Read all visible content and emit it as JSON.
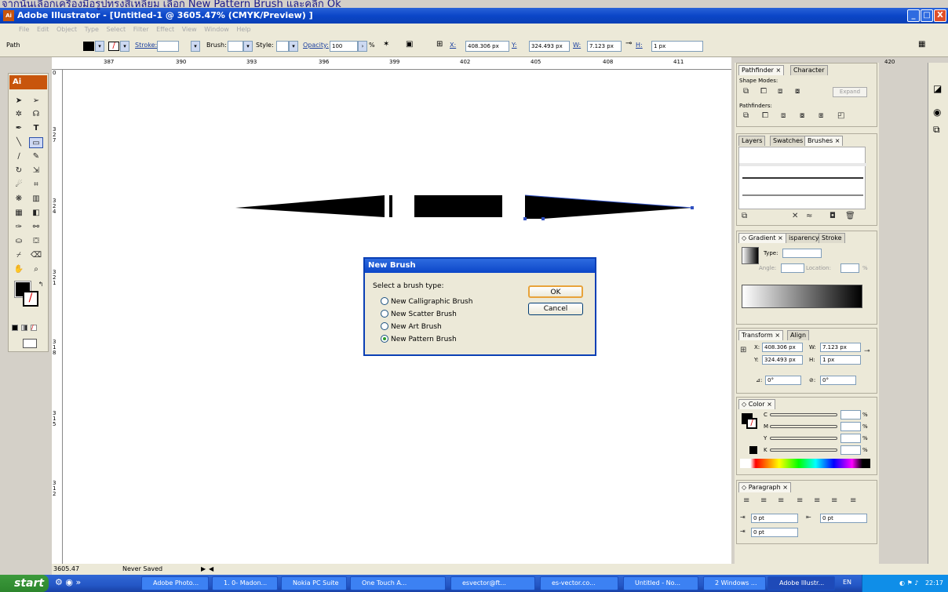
{
  "caption": "จากนั้นเลือกเครื่องมือรูปทรงสี่เหลี่ยม เลือก New Pattern Brush และคลิก Ok",
  "window": {
    "title": "Adobe Illustrator - [Untitled-1 @ 3605.47% (CMYK/Preview) ]",
    "min": "_",
    "max": "□",
    "close": "X"
  },
  "menu": [
    "File",
    "Edit",
    "Object",
    "Type",
    "Select",
    "Filter",
    "Effect",
    "View",
    "Window",
    "Help"
  ],
  "control": {
    "path_label": "Path",
    "stroke_label": "Stroke:",
    "brush_label": "Brush:",
    "style_label": "Style:",
    "opacity_label": "Opacity:",
    "opacity_value": "100",
    "percent": "%",
    "x_label": "X:",
    "x_value": "408.306 px",
    "y_label": "Y:",
    "y_value": "324.493 px",
    "w_label": "W:",
    "w_value": "7.123 px",
    "h_label": "H:",
    "h_value": "1 px"
  },
  "ruler_top": [
    "387",
    "390",
    "393",
    "396",
    "399",
    "402",
    "405",
    "408",
    "411",
    "420"
  ],
  "ruler_left": [
    "3\n2\n7",
    "3\n2\n4",
    "3\n2\n1",
    "3\n1\n8",
    "3\n1\n5",
    "3\n1\n2"
  ],
  "ruler_left_top": "0",
  "toolbox": {
    "logo": "Ai"
  },
  "dialog": {
    "title": "New Brush",
    "prompt": "Select a brush type:",
    "options": [
      "New Calligraphic Brush",
      "New Scatter Brush",
      "New Art Brush",
      "New Pattern Brush"
    ],
    "selected": "New Pattern Brush",
    "ok": "OK",
    "cancel": "Cancel"
  },
  "panels": {
    "pathfinder": {
      "tab1": "Pathfinder ×",
      "tab2": "Character",
      "shape_modes": "Shape Modes:",
      "expand": "Expand",
      "pathfinders": "Pathfinders:"
    },
    "brushes": {
      "tab1": "Layers",
      "tab2": "Swatches",
      "tab3": "Brushes ×"
    },
    "gradient": {
      "tab1": "◇ Gradient ×",
      "tab2": "isparency",
      "tab3": "Stroke",
      "type_label": "Type:",
      "angle_label": "Angle:",
      "location_label": "Location:",
      "percent": "%"
    },
    "transform": {
      "tab1": "Transform ×",
      "tab2": "Align",
      "x_label": "X:",
      "x_value": "408.306 px",
      "y_label": "Y:",
      "y_value": "324.493 px",
      "w_label": "W:",
      "w_value": "7.123 px",
      "h_label": "H:",
      "h_value": "1 px",
      "rot_label": "⊿:",
      "rot_value": "0°",
      "shear_label": "⊘:",
      "shear_value": "0°"
    },
    "color": {
      "tab1": "◇ Color ×",
      "channels": [
        "C",
        "M",
        "Y",
        "K"
      ],
      "percent": "%"
    },
    "paragraph": {
      "tab1": "◇ Paragraph ×",
      "indent_left": "0 pt",
      "indent_right": "0 pt",
      "indent_first": "0 pt"
    }
  },
  "status": {
    "zoom": "3605.47",
    "save_state": "Never Saved"
  },
  "taskbar": {
    "start": "start",
    "buttons": [
      "Adobe Photo...",
      "1. 0- Madon...",
      "Nokia PC Suite",
      "One Touch A...",
      "esvector@ft...",
      "es-vector.co...",
      "Untitled - No...",
      "2 Windows ...",
      "Adobe Illustr..."
    ],
    "lang": "EN",
    "clock": "22:17"
  }
}
